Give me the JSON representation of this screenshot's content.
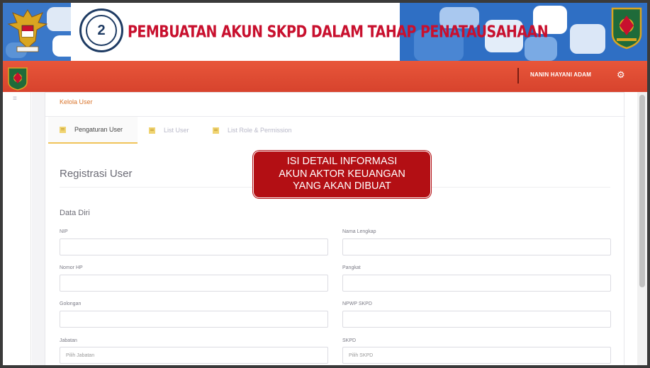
{
  "banner": {
    "step_number": "2",
    "title": "PEMBUATAN AKUN SKPD DALAM TAHAP PENATAUSAHAAN"
  },
  "header": {
    "user_name": "NANIN HAYANI ADAM",
    "settings_icon": "gear-icon"
  },
  "breadcrumb": "Kelola User",
  "tabs": [
    {
      "label": "Pengaturan User",
      "icon": "list-icon",
      "active": true
    },
    {
      "label": "List User",
      "icon": "list-icon",
      "active": false
    },
    {
      "label": "List Role & Permission",
      "icon": "list-icon",
      "active": false
    }
  ],
  "form": {
    "title": "Registrasi User",
    "section": "Data Diri",
    "fields": {
      "nip": {
        "label": "NIP",
        "value": ""
      },
      "nama": {
        "label": "Nama Lengkap",
        "value": ""
      },
      "hp": {
        "label": "Nomor HP",
        "value": ""
      },
      "pangkat": {
        "label": "Pangkat",
        "value": ""
      },
      "golongan": {
        "label": "Golongan",
        "value": ""
      },
      "npwp": {
        "label": "NPWP SKPD",
        "value": ""
      },
      "jabatan": {
        "label": "Jabatan",
        "placeholder": "Pilih Jabatan"
      },
      "skpd": {
        "label": "SKPD",
        "placeholder": "Pilih SKPD"
      }
    }
  },
  "callout": {
    "line1": "ISI DETAIL INFORMASI",
    "line2": "AKUN AKTOR KEUANGAN",
    "line3": "YANG AKAN DIBUAT"
  },
  "colors": {
    "appbar": "#d7432d",
    "banner_title": "#c8102e",
    "callout": "#b30f14",
    "breadcrumb": "#d9742b",
    "tab_active_underline": "#f0c35a"
  }
}
